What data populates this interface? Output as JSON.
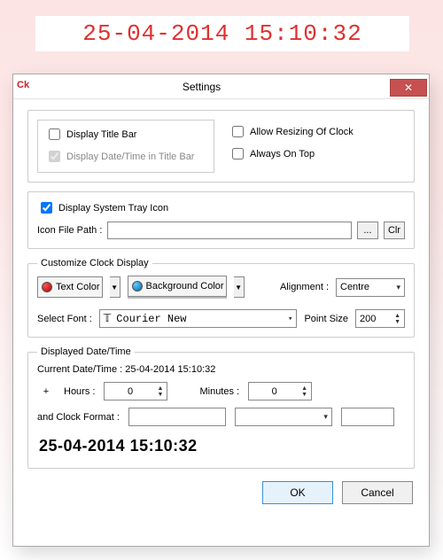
{
  "clock_display": "25-04-2014 15:10:32",
  "dialog": {
    "app_id": "Ck",
    "title": "Settings",
    "close_glyph": "✕"
  },
  "titlebar_group": {
    "display_titlebar": {
      "label": "Display Title Bar",
      "checked": false
    },
    "display_dt_in_titlebar": {
      "label": "Display Date/Time in Title Bar",
      "checked": true
    },
    "allow_resize": {
      "label": "Allow Resizing Of Clock",
      "checked": false
    },
    "always_on_top": {
      "label": "Always On Top",
      "checked": false
    }
  },
  "tray": {
    "display_tray_icon": {
      "label": "Display System Tray Icon",
      "checked": true
    },
    "icon_path_label": "Icon File Path :",
    "icon_path_value": "",
    "browse_label": "...",
    "clear_label": "Clr"
  },
  "customize": {
    "legend": "Customize Clock Display",
    "text_color_label": "Text Color",
    "bg_color_label": "Background Color",
    "alignment_label": "Alignment :",
    "alignment_value": "Centre",
    "select_font_label": "Select Font :",
    "font_value": "Courier New",
    "point_size_label": "Point Size",
    "point_size_value": "200"
  },
  "datetime": {
    "legend": "Displayed Date/Time",
    "current_label": "Current Date/Time : 25-04-2014 15:10:32",
    "plus": "+",
    "hours_label": "Hours :",
    "hours_value": "0",
    "minutes_label": "Minutes :",
    "minutes_value": "0",
    "format_label": "and Clock Format :",
    "fmt1": "",
    "fmt2": "",
    "fmt3": "",
    "preview": "25-04-2014 15:10:32"
  },
  "buttons": {
    "ok": "OK",
    "cancel": "Cancel"
  }
}
